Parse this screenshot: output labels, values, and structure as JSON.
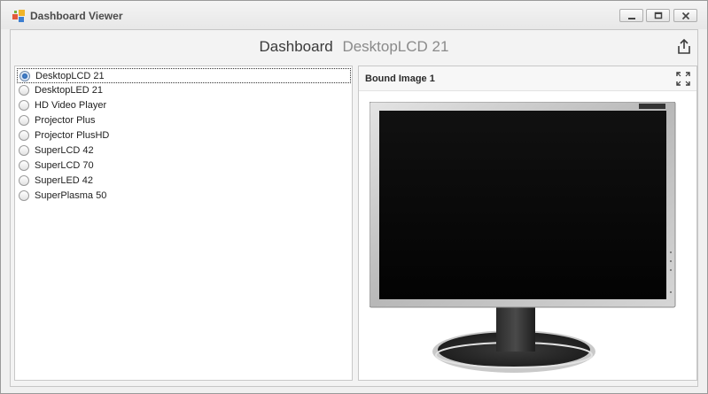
{
  "window": {
    "title": "Dashboard Viewer",
    "icons": [
      "app-icon",
      "minimize-icon",
      "maximize-icon",
      "close-icon"
    ]
  },
  "dashboard": {
    "title": "Dashboard",
    "subtitle": "DesktopLCD 21",
    "export_icon": "export-icon"
  },
  "list": {
    "selected": "DesktopLCD 21",
    "items": [
      "DesktopLCD 21",
      "DesktopLED 21",
      "HD Video Player",
      "Projector Plus",
      "Projector PlusHD",
      "SuperLCD 42",
      "SuperLCD 70",
      "SuperLED 42",
      "SuperPlasma 50"
    ]
  },
  "image_panel": {
    "caption": "Bound Image 1",
    "maximize_icon": "expand-icon",
    "image": "desktop-monitor-photo"
  },
  "colors": {
    "radio_selected": "#2a64b0",
    "panel_border": "#c8c8c8",
    "screen": "#050505"
  }
}
